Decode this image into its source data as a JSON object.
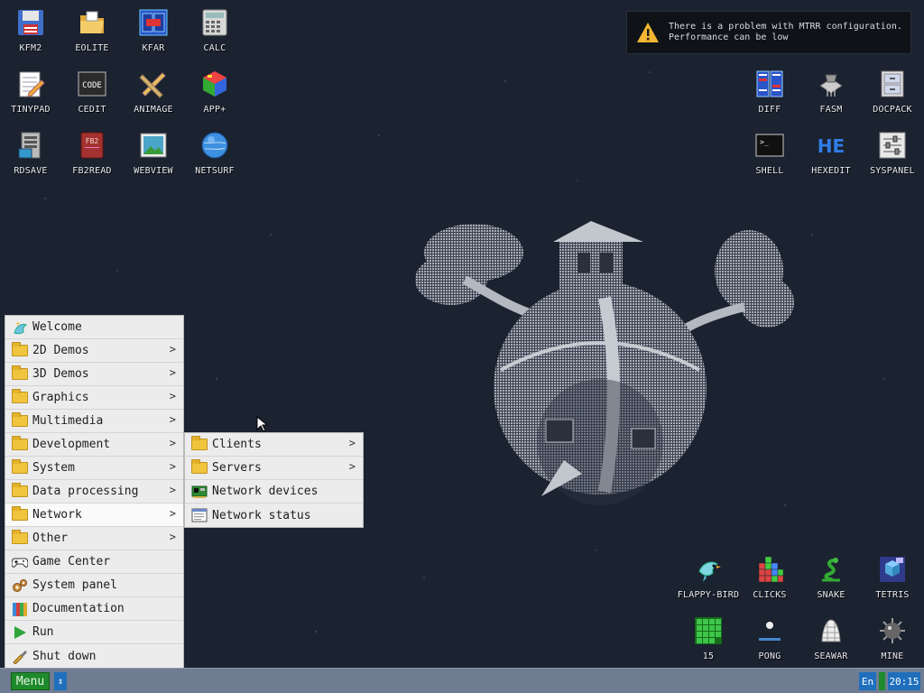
{
  "desktop": {
    "icons_left": [
      {
        "label": "KFM2",
        "icon": "floppy-disk-icon"
      },
      {
        "label": "EOLITE",
        "icon": "folder-open-icon"
      },
      {
        "label": "KFAR",
        "icon": "dual-panel-icon"
      },
      {
        "label": "CALC",
        "icon": "calculator-icon"
      },
      {
        "label": "TINYPAD",
        "icon": "notepad-icon"
      },
      {
        "label": "CEDIT",
        "icon": "code-icon"
      },
      {
        "label": "ANIMAGE",
        "icon": "pencil-ruler-icon"
      },
      {
        "label": "APP+",
        "icon": "cube-icon"
      },
      {
        "label": "RDSAVE",
        "icon": "ram-disk-icon"
      },
      {
        "label": "FB2READ",
        "icon": "book-icon"
      },
      {
        "label": "WEBVIEW",
        "icon": "picture-icon"
      },
      {
        "label": "NETSURF",
        "icon": "globe-icon"
      }
    ],
    "icons_right": [
      {
        "label": "DIFF",
        "icon": "diff-icon"
      },
      {
        "label": "FASM",
        "icon": "assembler-icon"
      },
      {
        "label": "DOCPACK",
        "icon": "cabinet-icon"
      },
      {
        "label": "SHELL",
        "icon": "terminal-icon"
      },
      {
        "label": "HEXEDIT",
        "icon": "hex-icon"
      },
      {
        "label": "SYSPANEL",
        "icon": "sliders-icon"
      }
    ],
    "icons_games": [
      {
        "label": "FLAPPY-BIRD",
        "icon": "bird-icon"
      },
      {
        "label": "CLICKS",
        "icon": "blocks-icon"
      },
      {
        "label": "SNAKE",
        "icon": "snake-icon"
      },
      {
        "label": "TETRIS",
        "icon": "tetris-icon"
      },
      {
        "label": "15",
        "icon": "puzzle-grid-icon"
      },
      {
        "label": "PONG",
        "icon": "pong-icon"
      },
      {
        "label": "SEAWAR",
        "icon": "seawar-icon"
      },
      {
        "label": "MINE",
        "icon": "mine-icon"
      }
    ]
  },
  "notification": {
    "line1": "There is a problem with MTRR configuration.",
    "line2": "Performance can be low",
    "icon": "warning-icon"
  },
  "menu": {
    "items": [
      {
        "label": "Welcome",
        "icon": "welcome-icon",
        "arrow": ""
      },
      {
        "label": "2D Demos",
        "icon": "folder-icon",
        "arrow": ">"
      },
      {
        "label": "3D Demos",
        "icon": "folder-icon",
        "arrow": ">"
      },
      {
        "label": "Graphics",
        "icon": "folder-icon",
        "arrow": ">"
      },
      {
        "label": "Multimedia",
        "icon": "folder-icon",
        "arrow": ">"
      },
      {
        "label": "Development",
        "icon": "folder-icon",
        "arrow": ">"
      },
      {
        "label": "System",
        "icon": "folder-icon",
        "arrow": ">"
      },
      {
        "label": "Data processing",
        "icon": "folder-icon",
        "arrow": ">"
      },
      {
        "label": "Network",
        "icon": "folder-icon",
        "arrow": ">"
      },
      {
        "label": "Other",
        "icon": "folder-icon",
        "arrow": ">"
      },
      {
        "label": "Game Center",
        "icon": "gamepad-icon",
        "arrow": ""
      },
      {
        "label": "System panel",
        "icon": "gears-icon",
        "arrow": ""
      },
      {
        "label": "Documentation",
        "icon": "books-icon",
        "arrow": ""
      },
      {
        "label": "Run",
        "icon": "play-icon",
        "arrow": ""
      },
      {
        "label": "Shut down",
        "icon": "power-icon",
        "arrow": ""
      }
    ],
    "active_index": 8
  },
  "submenu": {
    "items": [
      {
        "label": "Clients",
        "icon": "folder-icon",
        "arrow": ">"
      },
      {
        "label": "Servers",
        "icon": "folder-icon",
        "arrow": ">"
      },
      {
        "label": "Network devices",
        "icon": "network-card-icon",
        "arrow": ""
      },
      {
        "label": "Network status",
        "icon": "status-window-icon",
        "arrow": ""
      }
    ]
  },
  "taskbar": {
    "menu_label": "Menu",
    "arrow_label": "↕",
    "language": "En",
    "clock": "20:15"
  },
  "colors": {
    "background": "#1b2230",
    "taskbar": "#6f7c92",
    "menu_button": "#1f8a2c",
    "accent_blue": "#1f6fbd",
    "menu_bg": "#e9e9e9"
  }
}
